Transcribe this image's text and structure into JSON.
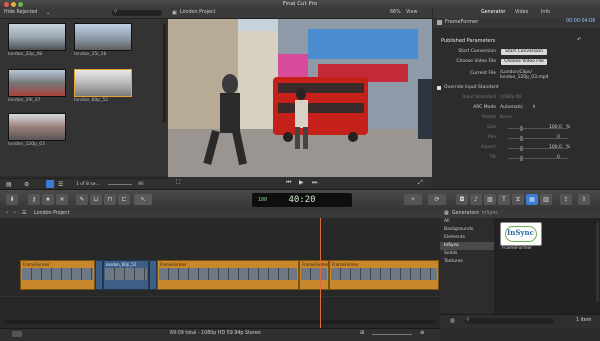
{
  "app": {
    "title": "Final Cut Pro"
  },
  "browser": {
    "filter": "Hide Rejected",
    "clips": [
      {
        "name": "london_22p_48"
      },
      {
        "name": "london_25i_2b"
      },
      {
        "name": "london_29i_37"
      },
      {
        "name": "london_60p_52"
      },
      {
        "name": "london_120p_03"
      }
    ],
    "footer": {
      "selection": "1 of 8 se...",
      "all": "All"
    }
  },
  "viewer": {
    "title": "London Project",
    "zoom": "66%",
    "view": "View"
  },
  "inspector": {
    "tabs": [
      "Generator",
      "Video",
      "Info"
    ],
    "generator_name": "FrameFormer",
    "duration": "00:00:04:06",
    "section_title": "Published Parameters",
    "rows": {
      "start_conversion_label": "Start Conversion",
      "start_conversion_button": "Start Conversion",
      "choose_video_label": "Choose Video File",
      "choose_video_button": "Choose Video File",
      "current_file_label": "Current File",
      "current_file_value": "/London/Clips/ london_120p_03.mp4",
      "override_label": "Override Input Standard",
      "input_standard_label": "Input Standard",
      "input_standard_value": "1080p 60",
      "arc_mode_label": "ARC Mode",
      "arc_mode_value": "Automatic",
      "preset_label": "Preset",
      "preset_value": "None",
      "size_label": "Size",
      "size_value": "100.0",
      "size_unit": "%",
      "pan_label": "Pan",
      "pan_value": "0",
      "aspect_label": "Aspect",
      "aspect_value": "100.0",
      "aspect_unit": "%",
      "tilt_label": "Tilt",
      "tilt_value": "0"
    }
  },
  "toolbar": {
    "timecode": "40:20",
    "rate": "100"
  },
  "timeline": {
    "project": "London Project",
    "clips": [
      {
        "name": "FrameFormer"
      },
      {
        "name": "london_60p_52"
      },
      {
        "name": "FrameFormer"
      },
      {
        "name": "FrameFormer"
      },
      {
        "name": "FrameFormer"
      }
    ],
    "status": "69:09 total - 1080p HD 59.94p Stereo"
  },
  "generators": {
    "header": "Generators",
    "subheader": "InSync",
    "list": [
      "All",
      "Backgrounds",
      "Elements",
      "InSync",
      "Solids",
      "Textures"
    ],
    "selected": "InSync",
    "items": [
      {
        "name": "FrameFormer",
        "logo": "InSync"
      }
    ],
    "count": "1 item"
  },
  "colors": {
    "accent": "#3a7bd5",
    "clip": "#c8872b",
    "playhead": "#e06a3a"
  }
}
